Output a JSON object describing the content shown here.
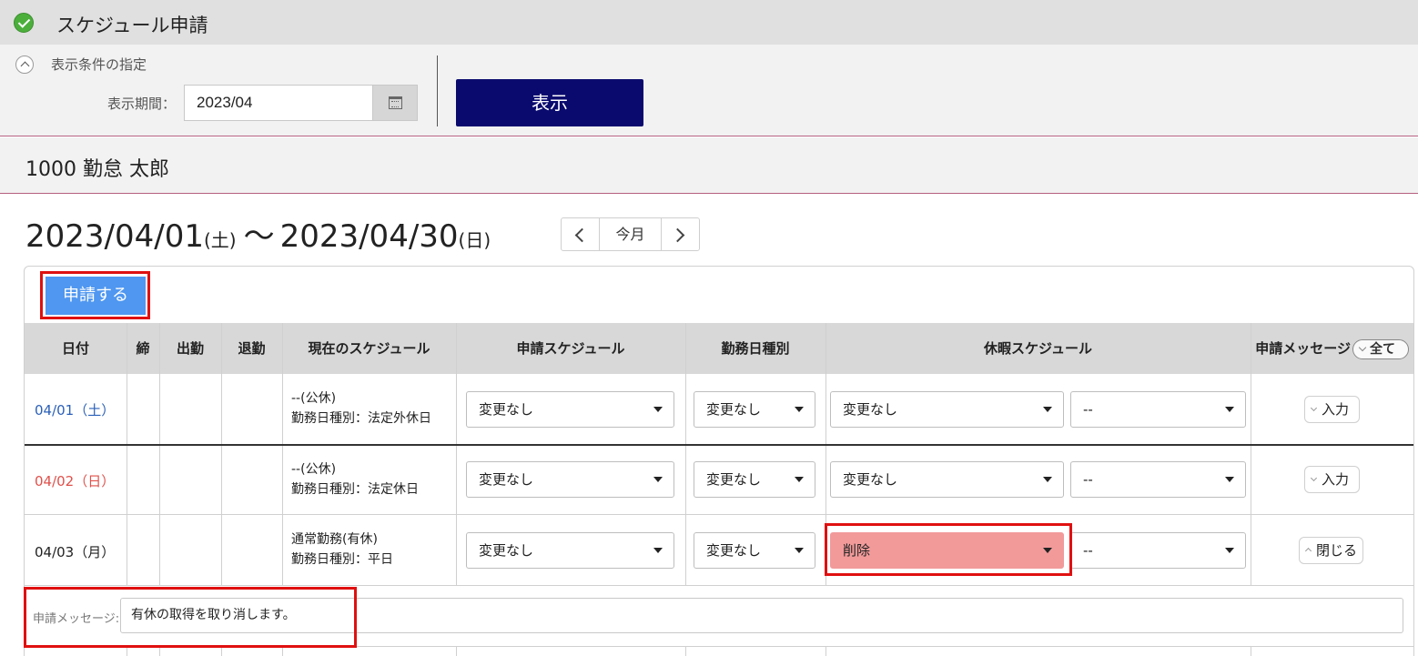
{
  "header": {
    "title": "スケジュール申請"
  },
  "conditions": {
    "section_label": "表示条件の指定",
    "period_label": "表示期間：",
    "period_value": "2023/04",
    "show_button": "表示"
  },
  "employee": {
    "name": "1000 勤怠 太郎"
  },
  "range": {
    "start": "2023/04/01",
    "start_dow": "(土)",
    "tilde": "～",
    "end": "2023/04/30",
    "end_dow": "(日)"
  },
  "nav": {
    "today": "今月"
  },
  "apply_button": "申請する",
  "table": {
    "headers": {
      "date": "日付",
      "close": "締",
      "in": "出勤",
      "out": "退勤",
      "current": "現在のスケジュール",
      "requested": "申請スケジュール",
      "daytype": "勤務日種別",
      "leave": "休暇スケジュール",
      "message": "申請メッセージ",
      "all": "全て"
    },
    "rows": [
      {
        "date": "04/01（土）",
        "sched1": "--(公休)",
        "sched2": "勤務日種別：法定外休日",
        "req": "変更なし",
        "daytype": "変更なし",
        "leave1": "変更なし",
        "leave2": "--",
        "msg_btn": "入力"
      },
      {
        "date": "04/02（日）",
        "sched1": "--(公休)",
        "sched2": "勤務日種別：法定休日",
        "req": "変更なし",
        "daytype": "変更なし",
        "leave1": "変更なし",
        "leave2": "--",
        "msg_btn": "入力"
      },
      {
        "date": "04/03（月）",
        "sched1": "通常勤務(有休)",
        "sched2": "勤務日種別：平日",
        "req": "変更なし",
        "daytype": "変更なし",
        "leave1": "削除",
        "leave2": "--",
        "msg_btn": "閉じる"
      }
    ]
  },
  "message_row": {
    "label": "申請メッセージ:",
    "value": "有休の取得を取り消します。"
  },
  "colors": {
    "title_bg": "#e0e0e0",
    "show_button_bg": "#0a0a6e",
    "apply_button_bg": "#4f97f0",
    "highlight_box": "#e01010",
    "delete_select_bg": "#f29a9a",
    "saturday_text": "#2a5fb8",
    "sunday_text": "#e0504a"
  }
}
